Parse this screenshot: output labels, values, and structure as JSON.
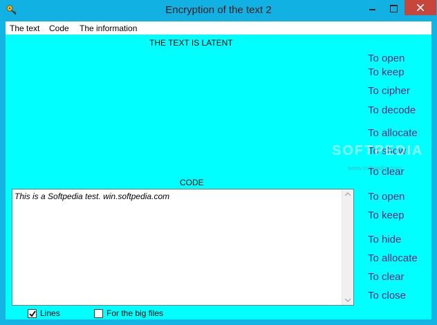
{
  "window": {
    "title": "Encryption of the text 2",
    "icon": "key-icon"
  },
  "menu": [
    "The text",
    "Code",
    "The information"
  ],
  "top_panel": {
    "label": "THE TEXT IS LATENT",
    "actions": [
      "To open",
      "To keep",
      "To cipher",
      "To decode",
      "To allocate",
      "To show",
      "To clear"
    ]
  },
  "bottom_panel": {
    "label": "CODE",
    "text": "This is a Softpedia test. win.softpedia.com",
    "actions": [
      "To open",
      "To keep",
      "To hide",
      "To allocate",
      "To clear",
      "To close"
    ]
  },
  "options": {
    "lines": {
      "label": "Lines",
      "checked": true
    },
    "big_files": {
      "label": "For the big files",
      "checked": false
    }
  },
  "watermark": {
    "text": "SOFTPEDIA",
    "sub": "www.softpedia.com"
  },
  "colors": {
    "client_bg": "#00ffff",
    "frame": "#14b4e4",
    "action_text": "#5a2a7a"
  }
}
